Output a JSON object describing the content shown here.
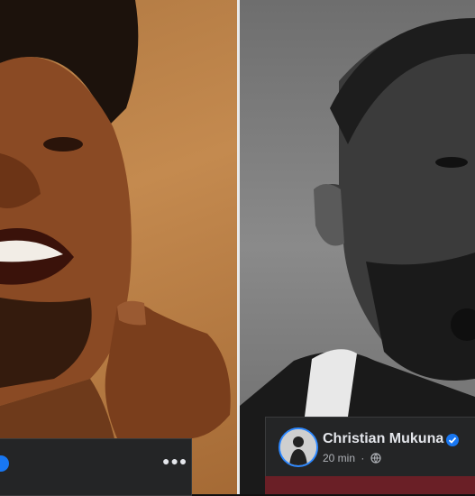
{
  "right_post": {
    "author": "Christian Mukuna",
    "time": "20 min",
    "separator": "·"
  },
  "icons": {
    "more": "more-options-icon",
    "verified": "verified-badge-icon",
    "audience": "globe-icon"
  },
  "colors": {
    "bar_bg": "#242526",
    "verified": "#1877f2",
    "text_primary": "#e4e6eb",
    "text_secondary": "#b0b3b8"
  }
}
